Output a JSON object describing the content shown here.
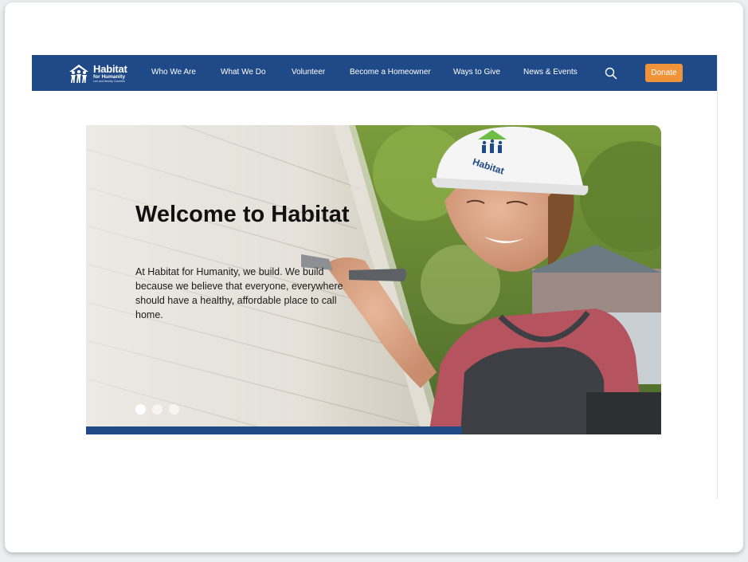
{
  "nav": {
    "logo": {
      "line1": "Habitat",
      "line2": "for Humanity",
      "line3": "Lee and Hendry Counties"
    },
    "items": [
      {
        "label": "Who We Are"
      },
      {
        "label": "What We Do"
      },
      {
        "label": "Volunteer"
      },
      {
        "label": "Become a Homeowner"
      },
      {
        "label": "Ways to Give"
      },
      {
        "label": "News & Events"
      }
    ],
    "search_icon": "search-icon",
    "donate_label": "Donate"
  },
  "hero": {
    "title": "Welcome to Habitat",
    "text": "At Habitat for Humanity, we build. We build because we believe that everyone, everywhere should have a healthy, affordable place to call home.",
    "helmet_text": "Habitat",
    "slides": {
      "count": 3,
      "active": 1
    }
  },
  "colors": {
    "brand_blue": "#1f4a87",
    "donate_orange": "#f0943b",
    "logo_green": "#6dbe45"
  }
}
